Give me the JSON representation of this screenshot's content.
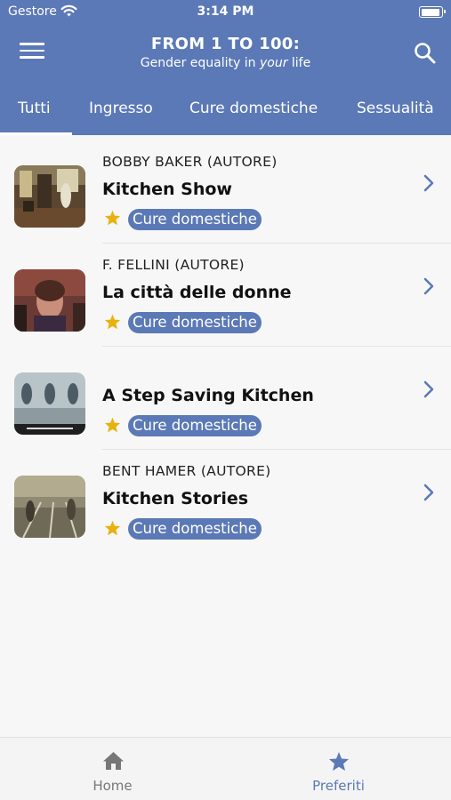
{
  "status": {
    "carrier": "Gestore",
    "time": "3:14 PM"
  },
  "header": {
    "title": "FROM 1 TO 100:",
    "subtitle_before": "Gender equality in ",
    "subtitle_em": "your",
    "subtitle_after": " life"
  },
  "tabs": [
    {
      "label": "Tutti",
      "active": true
    },
    {
      "label": "Ingresso"
    },
    {
      "label": "Cure domestiche"
    },
    {
      "label": "Sessualità"
    }
  ],
  "items": [
    {
      "author": "BOBBY BAKER (AUTORE)",
      "title": "Kitchen Show",
      "tag": "Cure domestiche",
      "favorite": true
    },
    {
      "author": "F. FELLINI (AUTORE)",
      "title": "La città delle donne",
      "tag": "Cure domestiche",
      "favorite": true
    },
    {
      "author": "",
      "title": "A Step Saving Kitchen",
      "tag": "Cure domestiche",
      "favorite": true
    },
    {
      "author": "BENT HAMER (AUTORE)",
      "title": "Kitchen Stories",
      "tag": "Cure domestiche",
      "favorite": true
    }
  ],
  "tabbar": {
    "home_label": "Home",
    "favorites_label": "Preferiti",
    "active": "favorites"
  },
  "colors": {
    "accent": "#5b79b6",
    "star": "#e8b20e",
    "inactive": "#777777"
  },
  "icons": [
    "menu-icon",
    "search-icon",
    "star-icon",
    "chevron-right-icon",
    "home-icon",
    "wifi-icon",
    "battery-icon"
  ]
}
